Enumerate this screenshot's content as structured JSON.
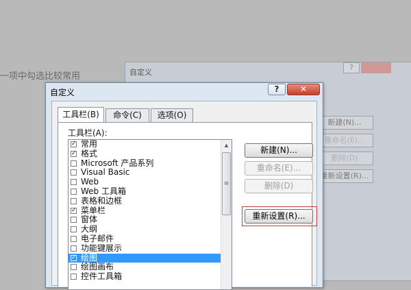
{
  "background": {
    "text": "一项中勾选比较常用",
    "window_title": "自定义",
    "help_label": "?",
    "buttons": [
      "新建(N)...",
      "重命名(E)...",
      "删除(D)",
      "重新设置(R)..."
    ]
  },
  "dialog": {
    "title": "自定义",
    "help_label": "?",
    "close_label": "✕",
    "tabs": [
      {
        "label": "工具栏(B)",
        "active": true
      },
      {
        "label": "命令(C)",
        "active": false
      },
      {
        "label": "选项(O)",
        "active": false
      }
    ],
    "list_label": "工具栏(A):",
    "toolbars": [
      {
        "label": "常用",
        "checked": true,
        "selected": false
      },
      {
        "label": "格式",
        "checked": true,
        "selected": false
      },
      {
        "label": "Microsoft 产品系列",
        "checked": false,
        "selected": false
      },
      {
        "label": "Visual Basic",
        "checked": false,
        "selected": false
      },
      {
        "label": "Web",
        "checked": false,
        "selected": false
      },
      {
        "label": "Web 工具箱",
        "checked": false,
        "selected": false
      },
      {
        "label": "表格和边框",
        "checked": false,
        "selected": false
      },
      {
        "label": "菜单栏",
        "checked": true,
        "selected": false
      },
      {
        "label": "窗体",
        "checked": false,
        "selected": false
      },
      {
        "label": "大纲",
        "checked": false,
        "selected": false
      },
      {
        "label": "电子邮件",
        "checked": false,
        "selected": false
      },
      {
        "label": "功能键展示",
        "checked": false,
        "selected": false
      },
      {
        "label": "绘图",
        "checked": true,
        "selected": true
      },
      {
        "label": "绘图画布",
        "checked": false,
        "selected": false
      },
      {
        "label": "控件工具箱",
        "checked": false,
        "selected": false
      }
    ],
    "buttons": {
      "new": "新建(N)...",
      "rename": "重命名(E)...",
      "delete": "删除(D)",
      "reset": "重新设置(R)..."
    },
    "scroll_grip": "≡",
    "accent_color": "#3399ff",
    "highlight_color": "#c0393b"
  }
}
